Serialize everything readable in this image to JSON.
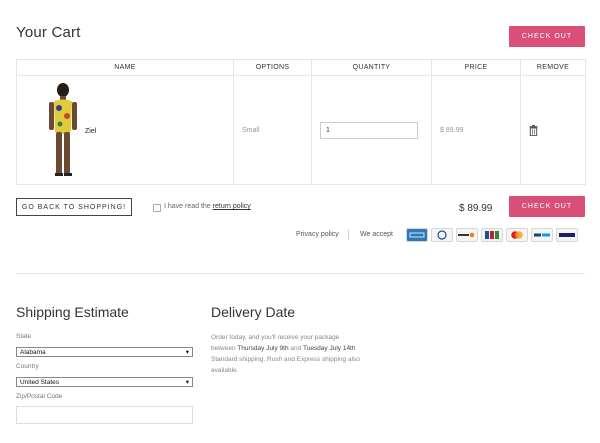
{
  "cart": {
    "title": "Your Cart",
    "checkout_label": "CHECK OUT",
    "columns": [
      "NAME",
      "OPTIONS",
      "QUANTITY",
      "PRICE",
      "REMOVE"
    ],
    "items": [
      {
        "name": "Ziel",
        "option": "Small",
        "quantity": "1",
        "price": "$ 89.99"
      }
    ],
    "back_label": "GO BACK TO SHOPPING!",
    "policy_prefix": "I have read the",
    "policy_link": "return policy",
    "total": "$ 89.99",
    "privacy_link": "Privacy policy",
    "we_accept": "We accept",
    "payment_icons": [
      "amex-icon",
      "diners-icon",
      "discover-icon",
      "jcb-icon",
      "mastercard-icon",
      "paypal-icon",
      "visa-icon"
    ]
  },
  "shipping": {
    "title": "Shipping Estimate",
    "state_label": "State",
    "state_value": "Alabama",
    "country_label": "Country",
    "country_value": "United States",
    "zip_label": "Zip/Postal Code",
    "zip_value": ""
  },
  "delivery": {
    "title": "Delivery Date",
    "line1": "Order today, and you'll receive your package",
    "line2_pre": "between",
    "date_start": "Thursday July 9th",
    "line2_mid": "and",
    "date_end": "Tuesday July 14th",
    "line3": "Standard shipping. Rush and Express shipping also",
    "line4": "available."
  },
  "colors": {
    "accent": "#d94f78"
  }
}
